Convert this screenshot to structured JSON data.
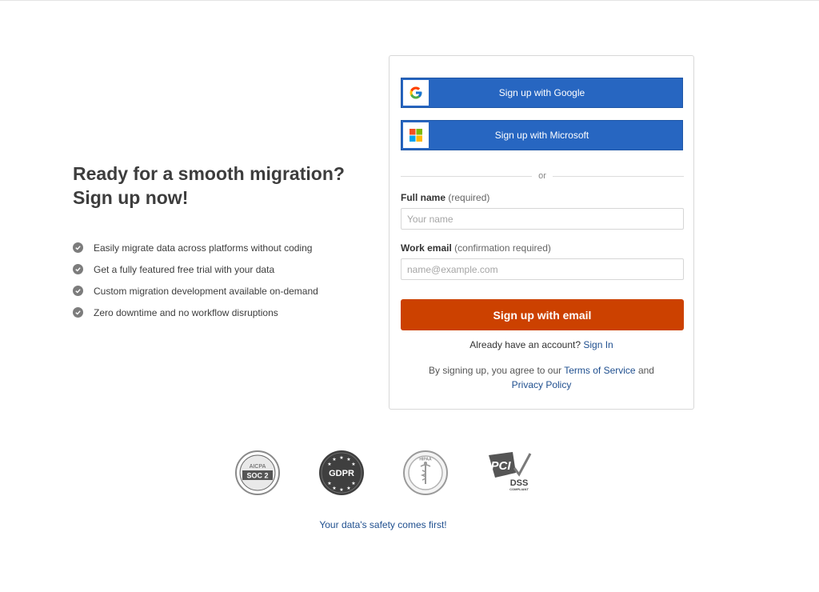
{
  "left": {
    "headline_line1": "Ready for a smooth migration?",
    "headline_line2": "Sign up now!",
    "benefits": [
      "Easily migrate data across platforms without coding",
      "Get a fully featured free trial with your data",
      "Custom migration development available on-demand",
      "Zero downtime and no workflow disruptions"
    ]
  },
  "form": {
    "google_label": "Sign up with Google",
    "microsoft_label": "Sign up with Microsoft",
    "divider_text": "or",
    "name_label": "Full name",
    "name_note": "(required)",
    "name_placeholder": "Your name",
    "email_label": "Work email",
    "email_note": "(confirmation required)",
    "email_placeholder": "name@example.com",
    "submit_label": "Sign up with email",
    "have_account_text": "Already have an account?",
    "signin_link": "Sign In",
    "terms_prefix": "By signing up, you agree to our",
    "terms_link": "Terms of Service",
    "terms_and": "and",
    "privacy_link": "Privacy Policy"
  },
  "badges": {
    "soc_top": "AICPA",
    "soc_main": "SOC 2",
    "gdpr": "GDPR",
    "hipaa": "HIPAA",
    "pci_main": "PCI",
    "pci_dss": "DSS",
    "pci_compliant": "COMPLIANT"
  },
  "footer": {
    "safety_text": "Your data's safety comes first!"
  },
  "colors": {
    "sso_blue": "#2766c1",
    "cta_orange": "#cc4100",
    "link_blue": "#1f4f8f"
  }
}
